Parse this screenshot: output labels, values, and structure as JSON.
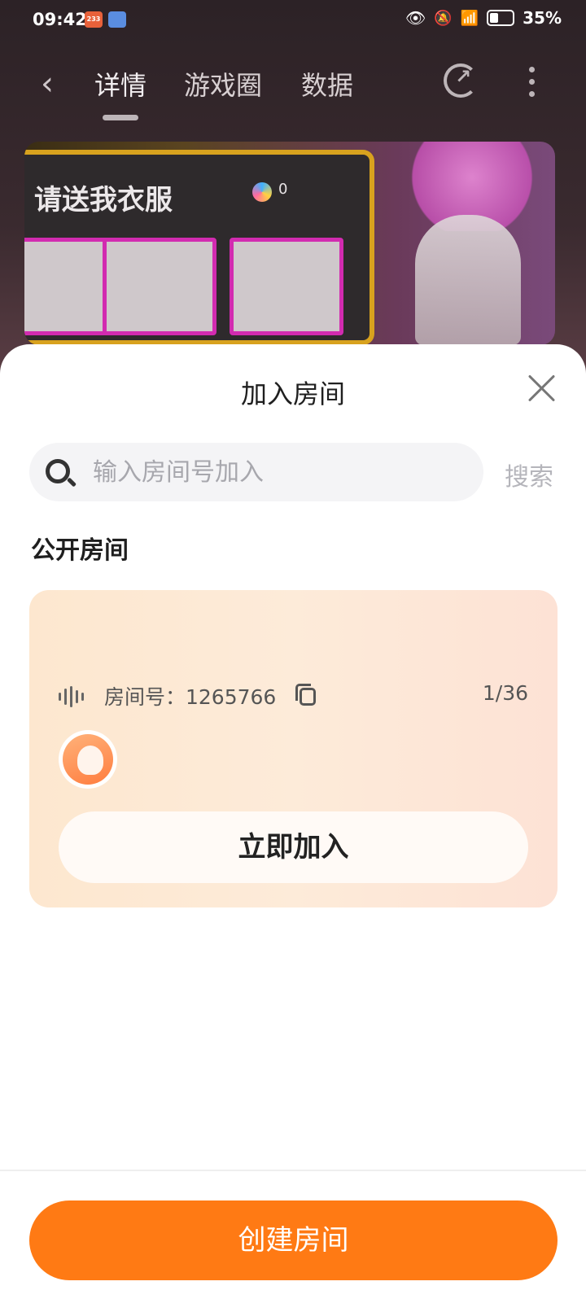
{
  "status_bar": {
    "time": "09:42",
    "app_badge_1": "233",
    "battery_percent": "35%"
  },
  "nav": {
    "tabs": [
      {
        "label": "详情",
        "active": true
      },
      {
        "label": "游戏圈",
        "active": false
      },
      {
        "label": "数据",
        "active": false
      }
    ]
  },
  "banner": {
    "title": "请送我衣服",
    "coin_value": "0"
  },
  "sheet": {
    "title": "加入房间",
    "search": {
      "placeholder": "输入房间号加入",
      "value": "",
      "button_label": "搜索"
    },
    "section_title": "公开房间",
    "rooms": [
      {
        "label": "房间号：1265766",
        "count": "1/36",
        "join_label": "立即加入"
      }
    ],
    "create_label": "创建房间"
  },
  "colors": {
    "accent": "#ff7a14",
    "room_card": "#fde7cf"
  }
}
